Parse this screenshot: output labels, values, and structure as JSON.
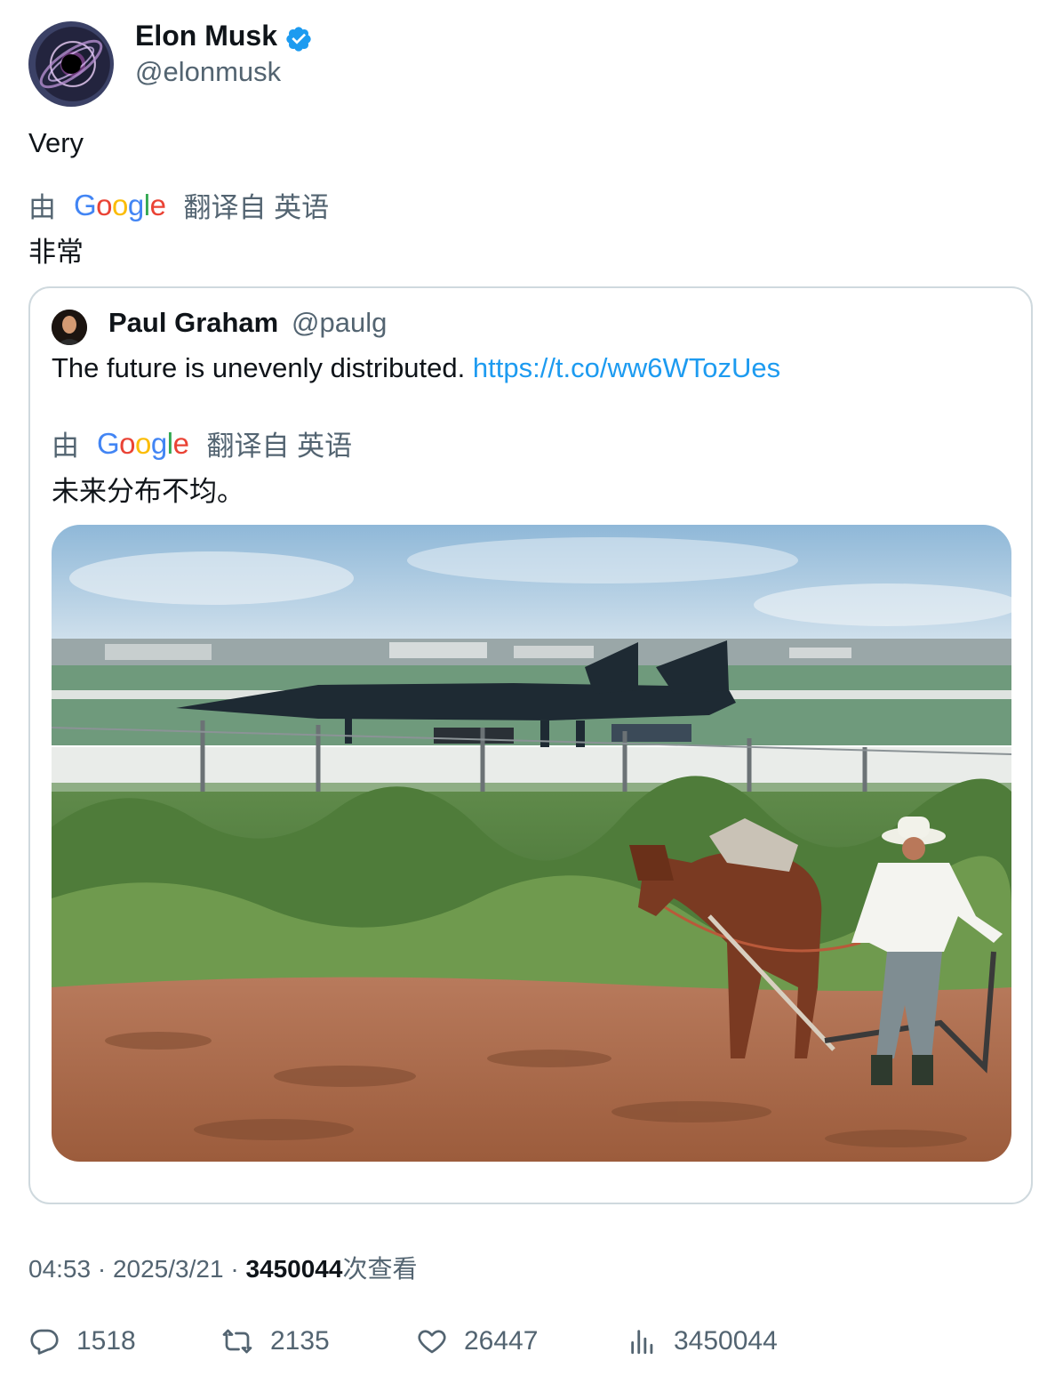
{
  "author": {
    "name": "Elon Musk",
    "handle": "@elonmusk",
    "avatar_icon": "black-hole-avatar",
    "verified_icon": "verified-badge-icon",
    "verified_color": "#1d9bf0"
  },
  "tweet": {
    "text": "Very",
    "translation": {
      "prefix": "由",
      "service_logo": "Google",
      "suffix": "翻译自 英语",
      "text": "非常"
    }
  },
  "quote": {
    "name": "Paul Graham",
    "handle": "@paulg",
    "text": "The future is unevenly distributed.",
    "link": "https://t.co/ww6WTozUes",
    "translation": {
      "prefix": "由",
      "service_logo": "Google",
      "suffix": "翻译自 英语",
      "text": "未来分布不均。"
    },
    "media_icon": "photo-sr71-blackbird-and-farmer-plowing"
  },
  "meta": {
    "time": "04:53",
    "separator": "·",
    "date": "2025/3/21",
    "views_count": "3450044",
    "views_label": "次查看"
  },
  "actions": {
    "replies": "1518",
    "retweets": "2135",
    "likes": "26447",
    "views": "3450044"
  },
  "colors": {
    "text": "#0f1419",
    "secondary": "#536471",
    "link": "#1d9bf0",
    "border": "#cfd9de"
  }
}
